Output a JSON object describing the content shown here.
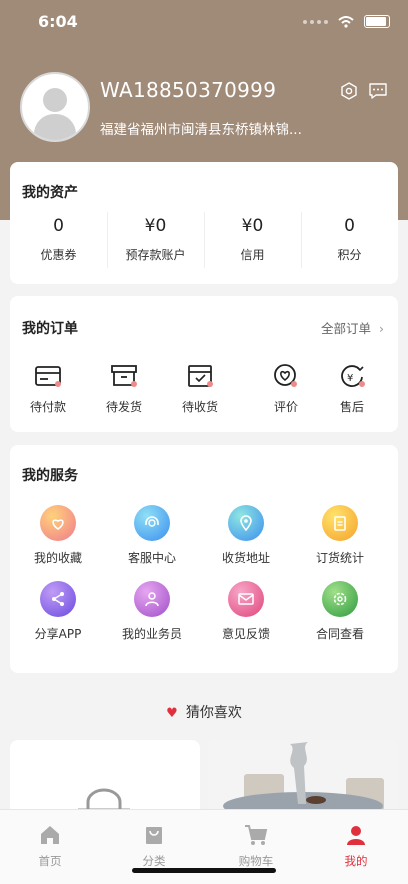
{
  "status_bar": {
    "time": "6:04"
  },
  "profile": {
    "username": "WA18850370999",
    "address": "福建省福州市闽清县东桥镇林锦..."
  },
  "assets": {
    "title": "我的资产",
    "items": [
      {
        "value": "0",
        "label": "优惠券"
      },
      {
        "value": "¥0",
        "label": "预存款账户"
      },
      {
        "value": "¥0",
        "label": "信用"
      },
      {
        "value": "0",
        "label": "积分"
      }
    ]
  },
  "orders": {
    "title": "我的订单",
    "all_link": "全部订单",
    "items": [
      {
        "label": "待付款",
        "icon": "card-icon"
      },
      {
        "label": "待发货",
        "icon": "box-icon"
      },
      {
        "label": "待收货",
        "icon": "receive-icon"
      },
      {
        "label": "评价",
        "icon": "review-icon"
      },
      {
        "label": "售后",
        "icon": "refund-icon"
      }
    ]
  },
  "services": {
    "title": "我的服务",
    "items": [
      {
        "label": "我的收藏",
        "icon": "heart-icon",
        "color": "#f5a14d"
      },
      {
        "label": "客服中心",
        "icon": "headset-icon",
        "color": "#4ea7ec"
      },
      {
        "label": "收货地址",
        "icon": "location-icon",
        "color": "#4ea7ec"
      },
      {
        "label": "订货统计",
        "icon": "clipboard-icon",
        "color": "#f5b82c"
      },
      {
        "label": "分享APP",
        "icon": "share-icon",
        "color": "#7b5ce8"
      },
      {
        "label": "我的业务员",
        "icon": "person-icon",
        "color": "#b05cc8"
      },
      {
        "label": "意见反馈",
        "icon": "mail-icon",
        "color": "#e8588a"
      },
      {
        "label": "合同查看",
        "icon": "settings-icon",
        "color": "#3fa84a"
      }
    ]
  },
  "guess": {
    "title": "猜你喜欢"
  },
  "tabbar": {
    "items": [
      {
        "label": "首页",
        "icon": "home-icon"
      },
      {
        "label": "分类",
        "icon": "bag-icon"
      },
      {
        "label": "购物车",
        "icon": "cart-icon"
      },
      {
        "label": "我的",
        "icon": "user-icon"
      }
    ],
    "active_color": "#e0303d"
  },
  "colors": {
    "header": "#a08a78",
    "accent": "#e0303d"
  }
}
